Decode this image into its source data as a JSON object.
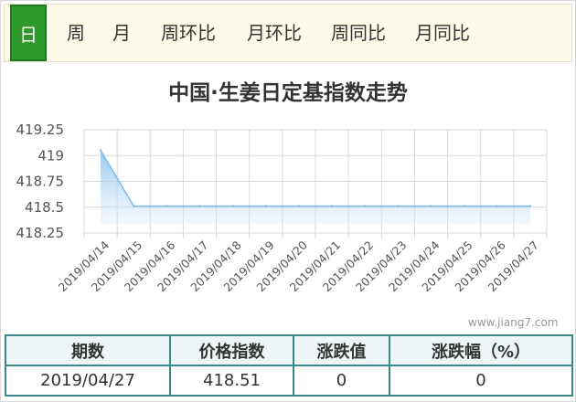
{
  "tabs": [
    "日",
    "周",
    "月",
    "周环比",
    "月环比",
    "周同比",
    "月同比"
  ],
  "active_tab": 0,
  "colors": {
    "accent": "#2e9a2e",
    "line": "#7db8e8",
    "fill": "#c9e1f6",
    "grid": "#d9d9d9",
    "table_border": "#3a8a8a"
  },
  "chart_data": {
    "type": "area",
    "title": "中国·生姜日定基指数走势",
    "xlabel": "",
    "ylabel": "",
    "x": [
      "2019/04/14",
      "2019/04/15",
      "2019/04/16",
      "2019/04/17",
      "2019/04/18",
      "2019/04/19",
      "2019/04/20",
      "2019/04/21",
      "2019/04/22",
      "2019/04/23",
      "2019/04/24",
      "2019/04/25",
      "2019/04/26",
      "2019/04/27"
    ],
    "series": [
      {
        "values": [
          419.05,
          418.51,
          418.51,
          418.51,
          418.51,
          418.51,
          418.51,
          418.51,
          418.51,
          418.51,
          418.51,
          418.51,
          418.51,
          418.51
        ]
      }
    ],
    "ylim": [
      418.25,
      419.25
    ],
    "yticks": [
      "418.25",
      "418.5",
      "418.75",
      "419",
      "419.25"
    ],
    "grid": true
  },
  "watermark": "www.jiang7.com",
  "table": {
    "headers": [
      "期数",
      "价格指数",
      "涨跌值",
      "涨跌幅（%）"
    ],
    "row": [
      "2019/04/27",
      "418.51",
      "0",
      "0"
    ]
  }
}
